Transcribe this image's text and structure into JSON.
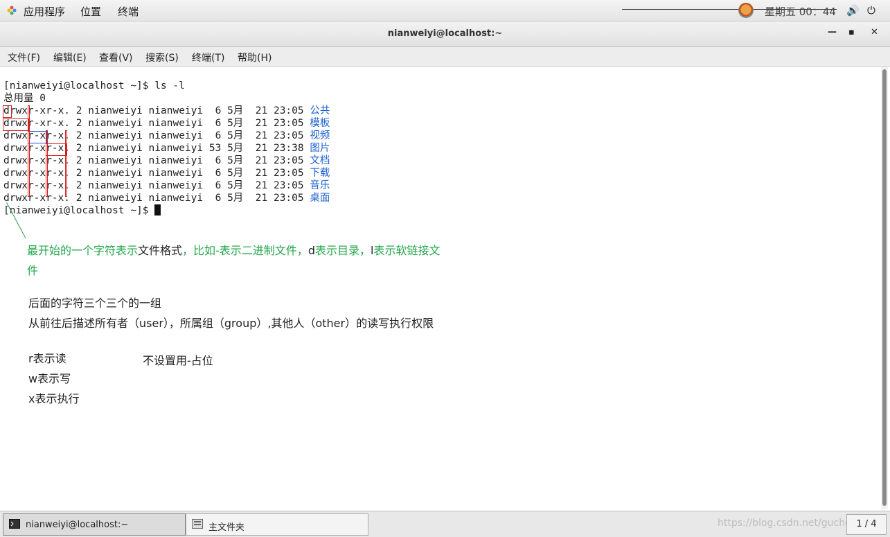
{
  "topbar": {
    "apps": "应用程序",
    "places": "位置",
    "terminal": "终端",
    "clock": "星期五 00：44",
    "icons": [
      "apps-icon",
      "user-avatar-icon",
      "volume-icon",
      "power-icon"
    ]
  },
  "window": {
    "title": "nianweiyi@localhost:~",
    "minimize": "—",
    "maximize": "▪",
    "close": "✕"
  },
  "menubar": [
    "文件(F)",
    "编辑(E)",
    "查看(V)",
    "搜索(S)",
    "终端(T)",
    "帮助(H)"
  ],
  "terminal": {
    "prompt1": "[nianweiyi@localhost ~]$ ls -l",
    "total": "总用量 0",
    "rows": [
      {
        "perm": "drwxr-xr-x.",
        "links": "2",
        "owner": "nianweiyi",
        "group": "nianweiyi",
        "size": " 6",
        "month": "5月",
        "day": "21",
        "time": "23:05",
        "name": "公共"
      },
      {
        "perm": "drwxr-xr-x.",
        "links": "2",
        "owner": "nianweiyi",
        "group": "nianweiyi",
        "size": " 6",
        "month": "5月",
        "day": "21",
        "time": "23:05",
        "name": "模板"
      },
      {
        "perm": "drwxr-xr-x.",
        "links": "2",
        "owner": "nianweiyi",
        "group": "nianweiyi",
        "size": " 6",
        "month": "5月",
        "day": "21",
        "time": "23:05",
        "name": "视频"
      },
      {
        "perm": "drwxr-xr-x.",
        "links": "2",
        "owner": "nianweiyi",
        "group": "nianweiyi",
        "size": "53",
        "month": "5月",
        "day": "21",
        "time": "23:38",
        "name": "图片"
      },
      {
        "perm": "drwxr-xr-x.",
        "links": "2",
        "owner": "nianweiyi",
        "group": "nianweiyi",
        "size": " 6",
        "month": "5月",
        "day": "21",
        "time": "23:05",
        "name": "文档"
      },
      {
        "perm": "drwxr-xr-x.",
        "links": "2",
        "owner": "nianweiyi",
        "group": "nianweiyi",
        "size": " 6",
        "month": "5月",
        "day": "21",
        "time": "23:05",
        "name": "下载"
      },
      {
        "perm": "drwxr-xr-x.",
        "links": "2",
        "owner": "nianweiyi",
        "group": "nianweiyi",
        "size": " 6",
        "month": "5月",
        "day": "21",
        "time": "23:05",
        "name": "音乐"
      },
      {
        "perm": "drwxr-xr-x.",
        "links": "2",
        "owner": "nianweiyi",
        "group": "nianweiyi",
        "size": " 6",
        "month": "5月",
        "day": "21",
        "time": "23:05",
        "name": "桌面"
      }
    ],
    "prompt2": "[nianweiyi@localhost ~]$ "
  },
  "annotations": {
    "line1_a": "最开始的一个字符表示",
    "line1_b": "文件格式",
    "line1_c": "，比如-表示二进制文件，",
    "line1_d": "d",
    "line1_e": "表示目录，",
    "line1_f": "l",
    "line1_g": "表示软链接文",
    "line2": "件",
    "group_line1": "后面的字符三个三个的一组",
    "group_line2": "从前往后描述所有者（user），所属组（group）,其他人（other）的读写执行权限",
    "r": "r表示读",
    "w": "w表示写",
    "x": "x表示执行",
    "dash": "不设置用-占位"
  },
  "taskbar": {
    "tasks": [
      {
        "label": "nianweiyi@localhost:~",
        "icon": "terminal-icon"
      },
      {
        "label": "主文件夹",
        "icon": "folder-icon"
      }
    ],
    "watermark": "https://blog.csdn.net/guchengyijiu",
    "pager": "1 / 4"
  },
  "colors": {
    "annotation_green": "#22a64a",
    "dir_blue": "#1c5fd3",
    "box_red": "#d32020",
    "box_blue": "#2b4fd3"
  }
}
